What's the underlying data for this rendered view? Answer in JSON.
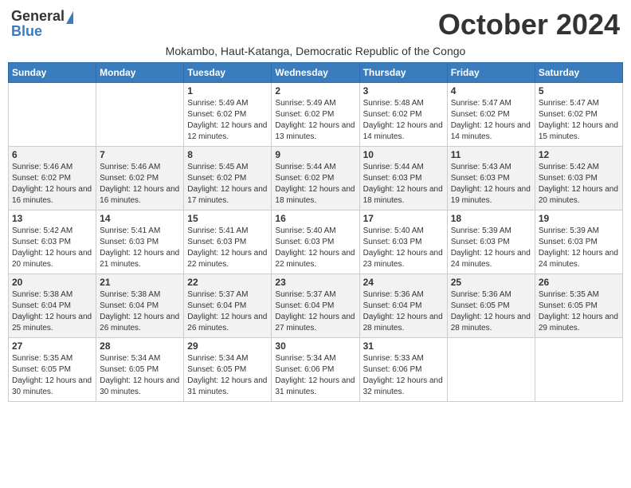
{
  "logo": {
    "line1": "General",
    "line2": "Blue"
  },
  "title": "October 2024",
  "subtitle": "Mokambo, Haut-Katanga, Democratic Republic of the Congo",
  "days_of_week": [
    "Sunday",
    "Monday",
    "Tuesday",
    "Wednesday",
    "Thursday",
    "Friday",
    "Saturday"
  ],
  "weeks": [
    [
      {
        "day": "",
        "content": ""
      },
      {
        "day": "",
        "content": ""
      },
      {
        "day": "1",
        "content": "Sunrise: 5:49 AM\nSunset: 6:02 PM\nDaylight: 12 hours and 12 minutes."
      },
      {
        "day": "2",
        "content": "Sunrise: 5:49 AM\nSunset: 6:02 PM\nDaylight: 12 hours and 13 minutes."
      },
      {
        "day": "3",
        "content": "Sunrise: 5:48 AM\nSunset: 6:02 PM\nDaylight: 12 hours and 14 minutes."
      },
      {
        "day": "4",
        "content": "Sunrise: 5:47 AM\nSunset: 6:02 PM\nDaylight: 12 hours and 14 minutes."
      },
      {
        "day": "5",
        "content": "Sunrise: 5:47 AM\nSunset: 6:02 PM\nDaylight: 12 hours and 15 minutes."
      }
    ],
    [
      {
        "day": "6",
        "content": "Sunrise: 5:46 AM\nSunset: 6:02 PM\nDaylight: 12 hours and 16 minutes."
      },
      {
        "day": "7",
        "content": "Sunrise: 5:46 AM\nSunset: 6:02 PM\nDaylight: 12 hours and 16 minutes."
      },
      {
        "day": "8",
        "content": "Sunrise: 5:45 AM\nSunset: 6:02 PM\nDaylight: 12 hours and 17 minutes."
      },
      {
        "day": "9",
        "content": "Sunrise: 5:44 AM\nSunset: 6:02 PM\nDaylight: 12 hours and 18 minutes."
      },
      {
        "day": "10",
        "content": "Sunrise: 5:44 AM\nSunset: 6:03 PM\nDaylight: 12 hours and 18 minutes."
      },
      {
        "day": "11",
        "content": "Sunrise: 5:43 AM\nSunset: 6:03 PM\nDaylight: 12 hours and 19 minutes."
      },
      {
        "day": "12",
        "content": "Sunrise: 5:42 AM\nSunset: 6:03 PM\nDaylight: 12 hours and 20 minutes."
      }
    ],
    [
      {
        "day": "13",
        "content": "Sunrise: 5:42 AM\nSunset: 6:03 PM\nDaylight: 12 hours and 20 minutes."
      },
      {
        "day": "14",
        "content": "Sunrise: 5:41 AM\nSunset: 6:03 PM\nDaylight: 12 hours and 21 minutes."
      },
      {
        "day": "15",
        "content": "Sunrise: 5:41 AM\nSunset: 6:03 PM\nDaylight: 12 hours and 22 minutes."
      },
      {
        "day": "16",
        "content": "Sunrise: 5:40 AM\nSunset: 6:03 PM\nDaylight: 12 hours and 22 minutes."
      },
      {
        "day": "17",
        "content": "Sunrise: 5:40 AM\nSunset: 6:03 PM\nDaylight: 12 hours and 23 minutes."
      },
      {
        "day": "18",
        "content": "Sunrise: 5:39 AM\nSunset: 6:03 PM\nDaylight: 12 hours and 24 minutes."
      },
      {
        "day": "19",
        "content": "Sunrise: 5:39 AM\nSunset: 6:03 PM\nDaylight: 12 hours and 24 minutes."
      }
    ],
    [
      {
        "day": "20",
        "content": "Sunrise: 5:38 AM\nSunset: 6:04 PM\nDaylight: 12 hours and 25 minutes."
      },
      {
        "day": "21",
        "content": "Sunrise: 5:38 AM\nSunset: 6:04 PM\nDaylight: 12 hours and 26 minutes."
      },
      {
        "day": "22",
        "content": "Sunrise: 5:37 AM\nSunset: 6:04 PM\nDaylight: 12 hours and 26 minutes."
      },
      {
        "day": "23",
        "content": "Sunrise: 5:37 AM\nSunset: 6:04 PM\nDaylight: 12 hours and 27 minutes."
      },
      {
        "day": "24",
        "content": "Sunrise: 5:36 AM\nSunset: 6:04 PM\nDaylight: 12 hours and 28 minutes."
      },
      {
        "day": "25",
        "content": "Sunrise: 5:36 AM\nSunset: 6:05 PM\nDaylight: 12 hours and 28 minutes."
      },
      {
        "day": "26",
        "content": "Sunrise: 5:35 AM\nSunset: 6:05 PM\nDaylight: 12 hours and 29 minutes."
      }
    ],
    [
      {
        "day": "27",
        "content": "Sunrise: 5:35 AM\nSunset: 6:05 PM\nDaylight: 12 hours and 30 minutes."
      },
      {
        "day": "28",
        "content": "Sunrise: 5:34 AM\nSunset: 6:05 PM\nDaylight: 12 hours and 30 minutes."
      },
      {
        "day": "29",
        "content": "Sunrise: 5:34 AM\nSunset: 6:05 PM\nDaylight: 12 hours and 31 minutes."
      },
      {
        "day": "30",
        "content": "Sunrise: 5:34 AM\nSunset: 6:06 PM\nDaylight: 12 hours and 31 minutes."
      },
      {
        "day": "31",
        "content": "Sunrise: 5:33 AM\nSunset: 6:06 PM\nDaylight: 12 hours and 32 minutes."
      },
      {
        "day": "",
        "content": ""
      },
      {
        "day": "",
        "content": ""
      }
    ]
  ]
}
